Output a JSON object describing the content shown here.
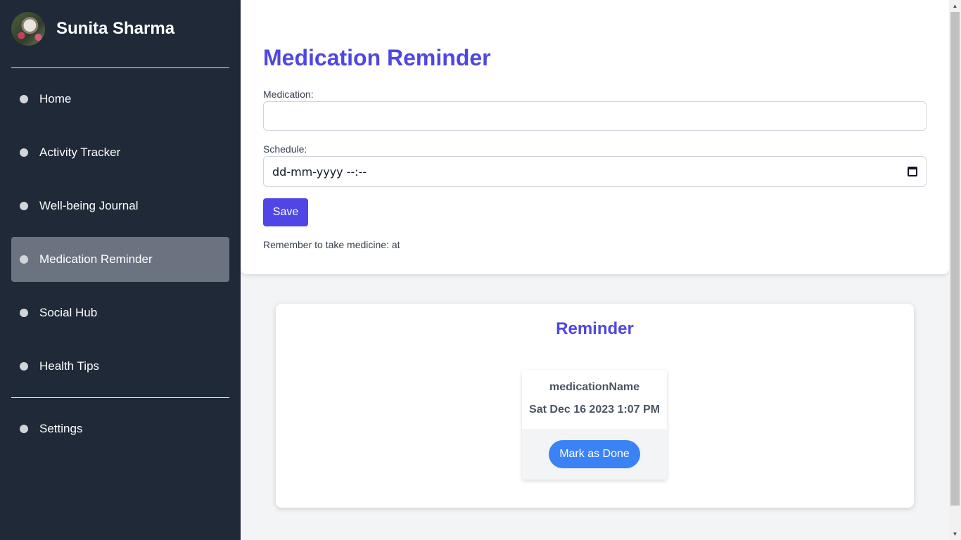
{
  "sidebar": {
    "user_name": "Sunita Sharma",
    "items": [
      {
        "label": "Home"
      },
      {
        "label": "Activity Tracker"
      },
      {
        "label": "Well-being Journal"
      },
      {
        "label": "Medication Reminder",
        "active": true
      },
      {
        "label": "Social Hub"
      },
      {
        "label": "Health Tips"
      }
    ],
    "settings_label": "Settings"
  },
  "form": {
    "title": "Medication Reminder",
    "medication_label": "Medication:",
    "medication_value": "",
    "schedule_label": "Schedule:",
    "schedule_placeholder": "dd-mm-yyyy --:--",
    "save_label": "Save",
    "remember_text": "Remember to take medicine: at"
  },
  "reminder": {
    "title": "Reminder",
    "medication_name": "medicationName",
    "time": "Sat Dec 16 2023 1:07 PM",
    "done_label": "Mark as Done"
  },
  "colors": {
    "sidebar_bg": "#1f2937",
    "accent": "#4f46e5",
    "done_button": "#3b82f6",
    "active_item_bg": "#6b7280"
  },
  "icons": {
    "calendar": "calendar-icon",
    "nav_bullet": "dot-icon"
  }
}
